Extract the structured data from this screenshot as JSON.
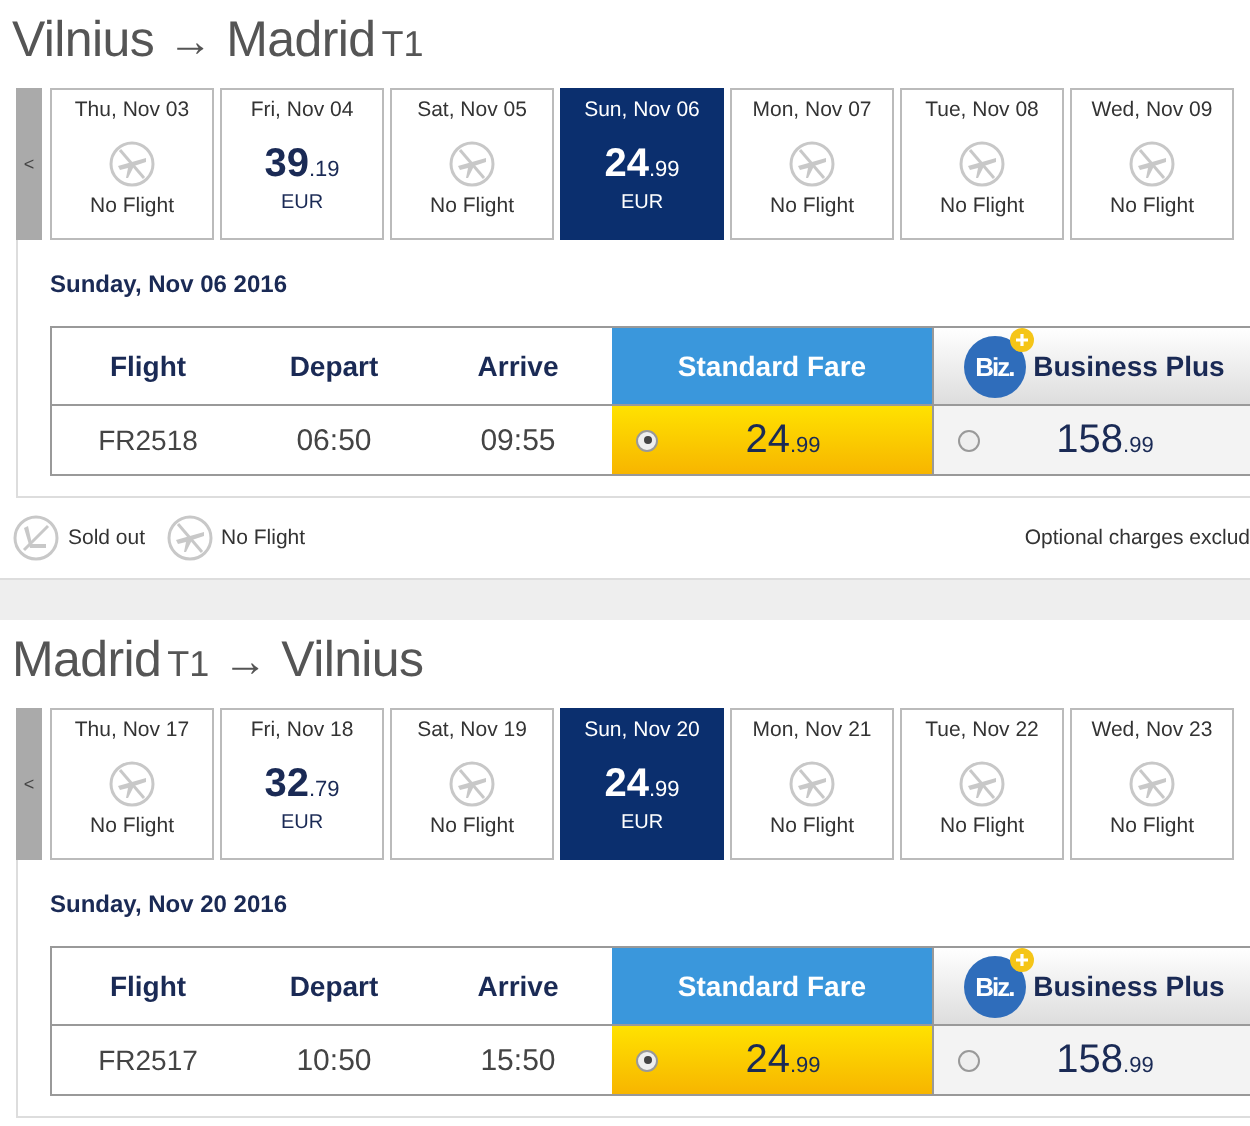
{
  "sections": [
    {
      "title": [
        {
          "kind": "city",
          "text": "Vilnius"
        },
        {
          "kind": "arrow",
          "text": "→"
        },
        {
          "kind": "city",
          "text": "Madrid"
        },
        {
          "kind": "terminal",
          "text": "T1"
        }
      ],
      "prev_button": "<",
      "dates": [
        {
          "day": "Thu, Nov 03",
          "kind": "no_flight",
          "label": "No Flight",
          "selected": false
        },
        {
          "day": "Fri, Nov 04",
          "kind": "price",
          "main": "39",
          "cents": ".19",
          "currency": "EUR",
          "selected": false
        },
        {
          "day": "Sat, Nov 05",
          "kind": "no_flight",
          "label": "No Flight",
          "selected": false
        },
        {
          "day": "Sun, Nov 06",
          "kind": "price",
          "main": "24",
          "cents": ".99",
          "currency": "EUR",
          "selected": true
        },
        {
          "day": "Mon, Nov 07",
          "kind": "no_flight",
          "label": "No Flight",
          "selected": false
        },
        {
          "day": "Tue, Nov 08",
          "kind": "no_flight",
          "label": "No Flight",
          "selected": false
        },
        {
          "day": "Wed, Nov 09",
          "kind": "no_flight",
          "label": "No Flight",
          "selected": false
        }
      ],
      "date_heading": "Sunday, Nov 06 2016",
      "columns": [
        "Flight",
        "Depart",
        "Arrive"
      ],
      "fares": [
        {
          "kind": "standard",
          "name": "Standard Fare"
        },
        {
          "kind": "business",
          "name": "Business Plus",
          "badge": "Biz."
        }
      ],
      "rows": [
        {
          "flight": "FR2518",
          "depart": "06:50",
          "arrive": "09:55",
          "prices": [
            {
              "main": "24",
              "cents": ".99",
              "selected": true
            },
            {
              "main": "158",
              "cents": ".99",
              "selected": false
            }
          ]
        }
      ],
      "legend": [
        {
          "kind": "sold_out",
          "label": "Sold out"
        },
        {
          "kind": "no_flight",
          "label": "No Flight"
        }
      ],
      "note": "Optional charges exclud"
    },
    {
      "title": [
        {
          "kind": "city",
          "text": "Madrid"
        },
        {
          "kind": "terminal",
          "text": "T1"
        },
        {
          "kind": "arrow",
          "text": "→"
        },
        {
          "kind": "city",
          "text": "Vilnius"
        }
      ],
      "prev_button": "<",
      "dates": [
        {
          "day": "Thu, Nov 17",
          "kind": "no_flight",
          "label": "No Flight",
          "selected": false
        },
        {
          "day": "Fri, Nov 18",
          "kind": "price",
          "main": "32",
          "cents": ".79",
          "currency": "EUR",
          "selected": false
        },
        {
          "day": "Sat, Nov 19",
          "kind": "no_flight",
          "label": "No Flight",
          "selected": false
        },
        {
          "day": "Sun, Nov 20",
          "kind": "price",
          "main": "24",
          "cents": ".99",
          "currency": "EUR",
          "selected": true
        },
        {
          "day": "Mon, Nov 21",
          "kind": "no_flight",
          "label": "No Flight",
          "selected": false
        },
        {
          "day": "Tue, Nov 22",
          "kind": "no_flight",
          "label": "No Flight",
          "selected": false
        },
        {
          "day": "Wed, Nov 23",
          "kind": "no_flight",
          "label": "No Flight",
          "selected": false
        }
      ],
      "date_heading": "Sunday, Nov 20 2016",
      "columns": [
        "Flight",
        "Depart",
        "Arrive"
      ],
      "fares": [
        {
          "kind": "standard",
          "name": "Standard Fare"
        },
        {
          "kind": "business",
          "name": "Business Plus",
          "badge": "Biz."
        }
      ],
      "rows": [
        {
          "flight": "FR2517",
          "depart": "10:50",
          "arrive": "15:50",
          "prices": [
            {
              "main": "24",
              "cents": ".99",
              "selected": true
            },
            {
              "main": "158",
              "cents": ".99",
              "selected": false
            }
          ]
        }
      ]
    }
  ]
}
